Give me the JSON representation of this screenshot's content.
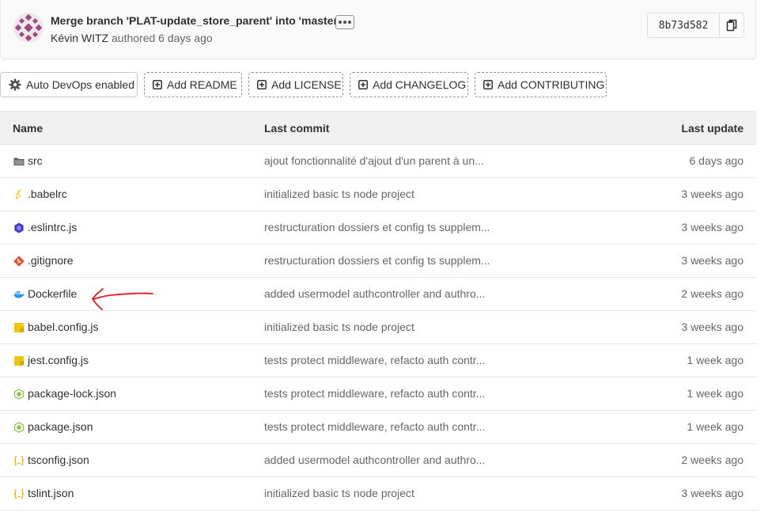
{
  "commit": {
    "title": "Merge branch 'PLAT-update_store_parent' into 'master'",
    "author": "Kévin WITZ",
    "authored_text": "authored 6 days ago",
    "sha": "8b73d582"
  },
  "actions": [
    {
      "label": "Auto DevOps enabled",
      "icon": "gear-icon"
    },
    {
      "label": "Add README",
      "icon": "plus-square-icon"
    },
    {
      "label": "Add LICENSE",
      "icon": "plus-square-icon"
    },
    {
      "label": "Add CHANGELOG",
      "icon": "plus-square-icon"
    },
    {
      "label": "Add CONTRIBUTING",
      "icon": "plus-square-icon"
    }
  ],
  "table": {
    "headers": {
      "name": "Name",
      "last_commit": "Last commit",
      "last_update": "Last update"
    },
    "rows": [
      {
        "name": "src",
        "icon": "folder-icon",
        "commit": "ajout fonctionnalité d'ajout d'un parent à un...",
        "updated": "6 days ago"
      },
      {
        "name": ".babelrc",
        "icon": "babel-icon",
        "commit": "initialized basic ts node project",
        "updated": "3 weeks ago"
      },
      {
        "name": ".eslintrc.js",
        "icon": "eslint-icon",
        "commit": "restructuration dossiers et config ts supplem...",
        "updated": "3 weeks ago"
      },
      {
        "name": ".gitignore",
        "icon": "git-icon",
        "commit": "restructuration dossiers et config ts supplem...",
        "updated": "3 weeks ago"
      },
      {
        "name": "Dockerfile",
        "icon": "docker-icon",
        "commit": "added usermodel authcontroller and authro...",
        "updated": "2 weeks ago"
      },
      {
        "name": "babel.config.js",
        "icon": "js-icon",
        "commit": "initialized basic ts node project",
        "updated": "3 weeks ago"
      },
      {
        "name": "jest.config.js",
        "icon": "js-icon",
        "commit": "tests protect middleware, refacto auth contr...",
        "updated": "1 week ago"
      },
      {
        "name": "package-lock.json",
        "icon": "nodejs-icon",
        "commit": "tests protect middleware, refacto auth contr...",
        "updated": "1 week ago"
      },
      {
        "name": "package.json",
        "icon": "nodejs-icon",
        "commit": "tests protect middleware, refacto auth contr...",
        "updated": "1 week ago"
      },
      {
        "name": "tsconfig.json",
        "icon": "json-icon",
        "commit": "added usermodel authcontroller and authro...",
        "updated": "2 weeks ago"
      },
      {
        "name": "tslint.json",
        "icon": "json-icon",
        "commit": "initialized basic ts node project",
        "updated": "3 weeks ago"
      }
    ]
  },
  "colors": {
    "annotation_arrow": "#e02020",
    "folder": "#5c5c5c",
    "js": "#f1c40f",
    "docker": "#2496ed",
    "git": "#e44c2c",
    "node": "#8bc34a",
    "json": "#f5b400",
    "eslint": "#4b32c3",
    "babel": "#f5da55"
  }
}
